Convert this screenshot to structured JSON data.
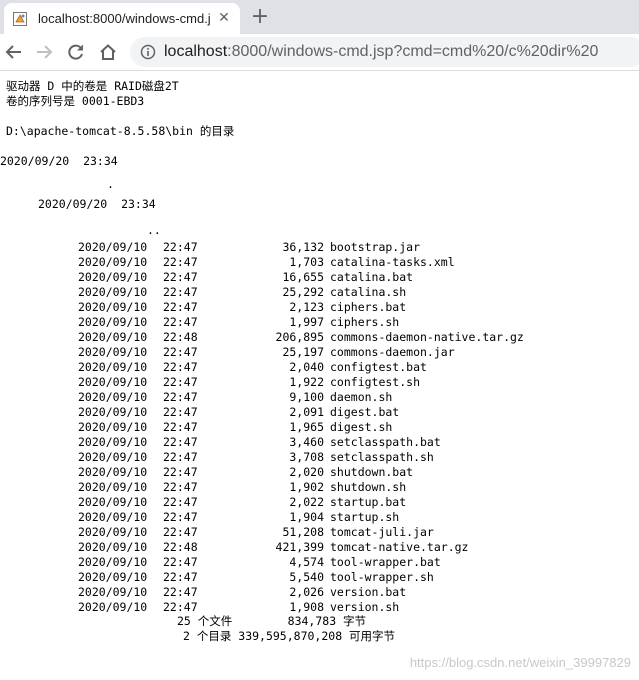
{
  "browser": {
    "tab_title": "localhost:8000/windows-cmd.j",
    "url_host": "localhost",
    "url_rest": ":8000/windows-cmd.jsp?cmd=cmd%20/c%20dir%20"
  },
  "output": {
    "volume_line": "驱动器 D 中的卷是 RAID磁盘2T",
    "serial_line": "卷的序列号是 0001-EBD3",
    "dir_line": "D:\\apache-tomcat-8.5.58\\bin 的目录",
    "first_date_line": "2020/09/20  23:34",
    "dot": ".",
    "second_date_line": "2020/09/20  23:34",
    "dotdot": "..",
    "files": [
      {
        "date": "2020/09/10",
        "time": "22:47",
        "size": "36,132",
        "name": "bootstrap.jar"
      },
      {
        "date": "2020/09/10",
        "time": "22:47",
        "size": "1,703",
        "name": "catalina-tasks.xml"
      },
      {
        "date": "2020/09/10",
        "time": "22:47",
        "size": "16,655",
        "name": "catalina.bat"
      },
      {
        "date": "2020/09/10",
        "time": "22:47",
        "size": "25,292",
        "name": "catalina.sh"
      },
      {
        "date": "2020/09/10",
        "time": "22:47",
        "size": "2,123",
        "name": "ciphers.bat"
      },
      {
        "date": "2020/09/10",
        "time": "22:47",
        "size": "1,997",
        "name": "ciphers.sh"
      },
      {
        "date": "2020/09/10",
        "time": "22:48",
        "size": "206,895",
        "name": "commons-daemon-native.tar.gz"
      },
      {
        "date": "2020/09/10",
        "time": "22:47",
        "size": "25,197",
        "name": "commons-daemon.jar"
      },
      {
        "date": "2020/09/10",
        "time": "22:47",
        "size": "2,040",
        "name": "configtest.bat"
      },
      {
        "date": "2020/09/10",
        "time": "22:47",
        "size": "1,922",
        "name": "configtest.sh"
      },
      {
        "date": "2020/09/10",
        "time": "22:47",
        "size": "9,100",
        "name": "daemon.sh"
      },
      {
        "date": "2020/09/10",
        "time": "22:47",
        "size": "2,091",
        "name": "digest.bat"
      },
      {
        "date": "2020/09/10",
        "time": "22:47",
        "size": "1,965",
        "name": "digest.sh"
      },
      {
        "date": "2020/09/10",
        "time": "22:47",
        "size": "3,460",
        "name": "setclasspath.bat"
      },
      {
        "date": "2020/09/10",
        "time": "22:47",
        "size": "3,708",
        "name": "setclasspath.sh"
      },
      {
        "date": "2020/09/10",
        "time": "22:47",
        "size": "2,020",
        "name": "shutdown.bat"
      },
      {
        "date": "2020/09/10",
        "time": "22:47",
        "size": "1,902",
        "name": "shutdown.sh"
      },
      {
        "date": "2020/09/10",
        "time": "22:47",
        "size": "2,022",
        "name": "startup.bat"
      },
      {
        "date": "2020/09/10",
        "time": "22:47",
        "size": "1,904",
        "name": "startup.sh"
      },
      {
        "date": "2020/09/10",
        "time": "22:47",
        "size": "51,208",
        "name": "tomcat-juli.jar"
      },
      {
        "date": "2020/09/10",
        "time": "22:48",
        "size": "421,399",
        "name": "tomcat-native.tar.gz"
      },
      {
        "date": "2020/09/10",
        "time": "22:47",
        "size": "4,574",
        "name": "tool-wrapper.bat"
      },
      {
        "date": "2020/09/10",
        "time": "22:47",
        "size": "5,540",
        "name": "tool-wrapper.sh"
      },
      {
        "date": "2020/09/10",
        "time": "22:47",
        "size": "2,026",
        "name": "version.bat"
      },
      {
        "date": "2020/09/10",
        "time": "22:47",
        "size": "1,908",
        "name": "version.sh"
      }
    ],
    "summary_files": "25 个文件        834,783 字节",
    "summary_dirs": "2 个目录 339,595,870,208 可用字节"
  },
  "watermark": "https://blog.csdn.net/weixin_39997829"
}
